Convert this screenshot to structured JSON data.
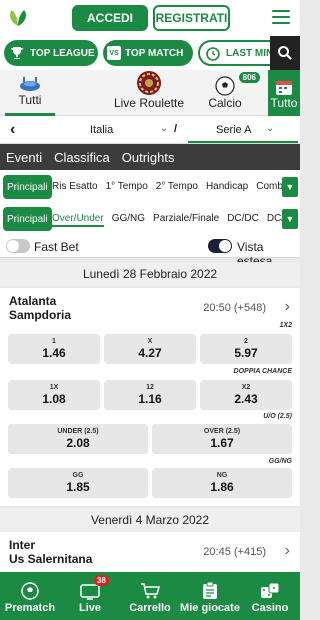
{
  "header": {
    "login_label": "ACCEDI",
    "register_label": "REGISTRATI"
  },
  "quickbar": {
    "top_league": "TOP LEAGUE",
    "top_match": "TOP MATCH",
    "last_minute": "LAST MINU"
  },
  "sport_tabs": [
    {
      "label": "Tutti",
      "icon": "stadium-icon"
    },
    {
      "label": "Live Roulette",
      "icon": "roulette-icon"
    },
    {
      "label": "Calcio",
      "icon": "soccer-ball-icon",
      "badge": "806"
    },
    {
      "label": "Tutto",
      "icon": "calendar-icon"
    }
  ],
  "league_nav": {
    "country": "Italia",
    "league": "Serie A"
  },
  "section_tabs": [
    "Eventi",
    "Classifica",
    "Outrights"
  ],
  "filters_row1": {
    "active": "Principali",
    "items": [
      "Ris Esatto",
      "1° Tempo",
      "2° Tempo",
      "Handicap",
      "Combo"
    ]
  },
  "filters_row2": {
    "active": "Principali",
    "items": [
      "Over/Under",
      "GG/NG",
      "Parziale/Finale",
      "DC/DC",
      "DC/Fi"
    ]
  },
  "toggles": {
    "fast_bet": "Fast Bet",
    "vista_estesa": "Vista estesa"
  },
  "date1": "Lunedì 28 Febbraio 2022",
  "match1": {
    "home": "Atalanta",
    "away": "Sampdoria",
    "time": "20:50",
    "more": "(+548)",
    "m1x2": {
      "label": "1X2",
      "odds": [
        {
          "l": "1",
          "v": "1.46"
        },
        {
          "l": "X",
          "v": "4.27"
        },
        {
          "l": "2",
          "v": "5.97"
        }
      ]
    },
    "dc": {
      "label": "DOPPIA CHANCE",
      "odds": [
        {
          "l": "1X",
          "v": "1.08"
        },
        {
          "l": "12",
          "v": "1.16"
        },
        {
          "l": "X2",
          "v": "2.43"
        }
      ]
    },
    "ou": {
      "label": "U/O (2.5)",
      "odds": [
        {
          "l": "UNDER (2.5)",
          "v": "2.08"
        },
        {
          "l": "OVER (2.5)",
          "v": "1.67"
        }
      ]
    },
    "ggng": {
      "label": "GG/NG",
      "odds": [
        {
          "l": "GG",
          "v": "1.85"
        },
        {
          "l": "NG",
          "v": "1.86"
        }
      ]
    }
  },
  "date2": "Venerdì 4 Marzo 2022",
  "match2": {
    "home": "Inter",
    "away": "Us Salernitana",
    "time": "20:45",
    "more": "(+415)"
  },
  "bottom_nav": [
    {
      "label": "Prematch",
      "icon": "soccer-ball-icon"
    },
    {
      "label": "Live",
      "icon": "tv-icon",
      "badge": "38"
    },
    {
      "label": "Carrello",
      "icon": "cart-icon"
    },
    {
      "label": "Mie giocate",
      "icon": "clipboard-icon"
    },
    {
      "label": "Casino",
      "icon": "dice-icon"
    }
  ],
  "colors": {
    "brand_green": "#1b8b44",
    "dark": "#3c3c3c",
    "badge_red": "#e02020"
  }
}
